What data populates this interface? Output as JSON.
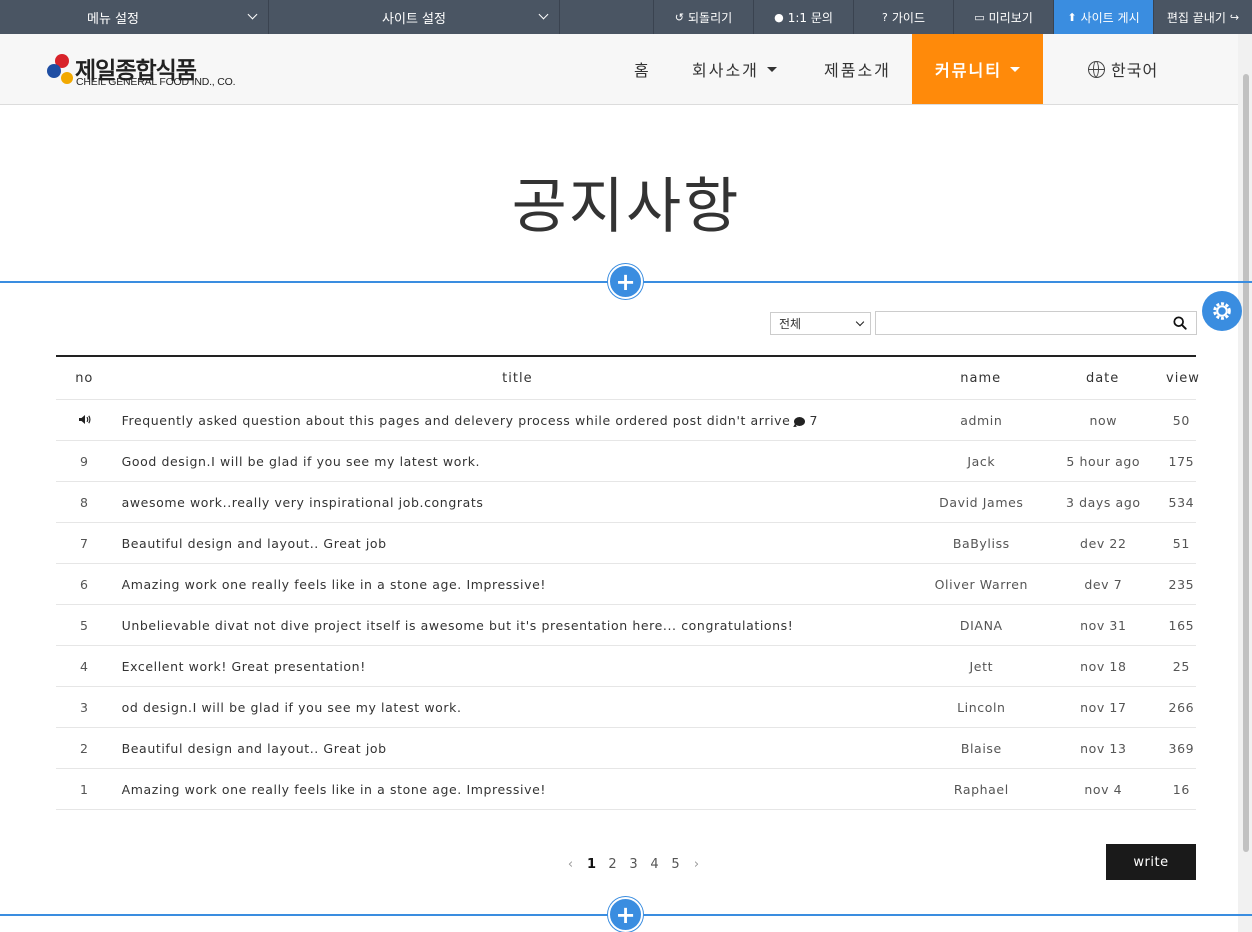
{
  "admin_bar": {
    "menu_settings": "메뉴 설정",
    "site_settings": "사이트 설정",
    "undo": "되돌리기",
    "inquiry": "1:1 문의",
    "guide": "가이드",
    "preview": "미리보기",
    "publish": "사이트 게시",
    "exit_edit": "편집 끝내기"
  },
  "header": {
    "logo_ko": "제일종합식품",
    "logo_en": "CHEIL GENERAL FOOD IND., CO.",
    "nav": {
      "home": "홈",
      "about": "회사소개",
      "products": "제품소개",
      "community": "커뮤니티",
      "language": "한국어"
    }
  },
  "page_title": "공지사항",
  "search": {
    "select_value": "전체",
    "input_value": ""
  },
  "board": {
    "columns": {
      "no": "no",
      "title": "title",
      "name": "name",
      "date": "date",
      "view": "view"
    },
    "notice": {
      "title": "Frequently asked question about this pages and delevery process while ordered post didn't arrive",
      "comments": "7",
      "name": "admin",
      "date": "now",
      "view": "50"
    },
    "rows": [
      {
        "no": "9",
        "title": "Good design.I will be glad if you see my latest work.",
        "name": "Jack",
        "date": "5 hour ago",
        "view": "175"
      },
      {
        "no": "8",
        "title": "awesome work..really very inspirational job.congrats",
        "name": "David James",
        "date": "3 days ago",
        "view": "534"
      },
      {
        "no": "7",
        "title": "Beautiful design and layout.. Great job",
        "name": "BaByliss",
        "date": "dev 22",
        "view": "51"
      },
      {
        "no": "6",
        "title": "Amazing work one really feels like in a stone age. Impressive!",
        "name": "Oliver Warren",
        "date": "dev 7",
        "view": "235"
      },
      {
        "no": "5",
        "title": "Unbelievable divat not dive project itself is awesome but it's presentation here... congratulations!",
        "name": "DIANA",
        "date": "nov 31",
        "view": "165"
      },
      {
        "no": "4",
        "title": "Excellent work! Great presentation!",
        "name": "Jett",
        "date": "nov 18",
        "view": "25"
      },
      {
        "no": "3",
        "title": "od design.I will be glad if you see my latest work.",
        "name": "Lincoln",
        "date": "nov 17",
        "view": "266"
      },
      {
        "no": "2",
        "title": "Beautiful design and layout.. Great job",
        "name": "Blaise",
        "date": "nov 13",
        "view": "369"
      },
      {
        "no": "1",
        "title": "Amazing work one really feels like in a stone age. Impressive!",
        "name": "Raphael",
        "date": "nov 4",
        "view": "16"
      }
    ]
  },
  "pagination": {
    "prev": "‹",
    "pages": [
      "1",
      "2",
      "3",
      "4",
      "5"
    ],
    "current": "1",
    "next": "›"
  },
  "write_label": "write",
  "icons": {
    "add": "+",
    "settings": "gear-icon",
    "search": "search-icon",
    "notice": "speaker-icon",
    "comment": "comment-icon"
  },
  "colors": {
    "admin_bar": "#4a5563",
    "primary_blue": "#3a8de0",
    "nav_active": "#ff8a0a",
    "write_button": "#1a1a1a"
  }
}
